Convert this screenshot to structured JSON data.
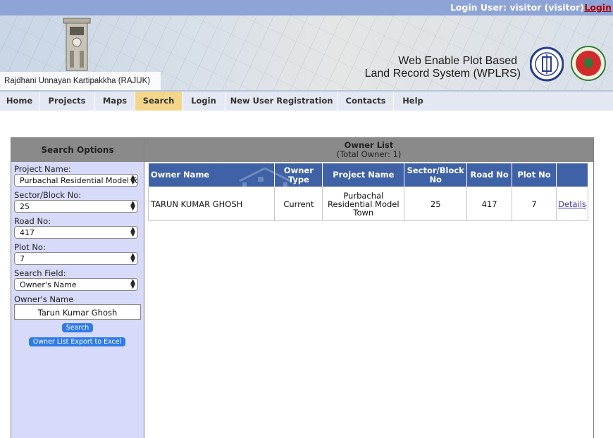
{
  "top": {
    "login_user": "Login User: visitor (visitor)",
    "login_link": "Login"
  },
  "banner": {
    "org_name": "Rajdhani Unnayan Kartipakkha (RAJUK)",
    "title_line1": "Web Enable Plot Based",
    "title_line2": "Land Record System (WPLRS)"
  },
  "nav": {
    "items": [
      {
        "label": "Home"
      },
      {
        "label": "Projects"
      },
      {
        "label": "Maps"
      },
      {
        "label": "Search"
      },
      {
        "label": "Login"
      },
      {
        "label": "New User Registration"
      },
      {
        "label": "Contacts"
      },
      {
        "label": "Help"
      }
    ],
    "active": "Search"
  },
  "search": {
    "heading": "Search Options",
    "project_label": "Project Name:",
    "project_value": "Purbachal Residential Model Town",
    "sector_label": "Sector/Block No:",
    "sector_value": "25",
    "road_label": "Road No:",
    "road_value": "417",
    "plot_label": "Plot No:",
    "plot_value": "7",
    "field_label": "Search Field:",
    "field_value": "Owner's Name",
    "owner_label": "Owner's Name",
    "owner_value": "Tarun Kumar Ghosh",
    "search_button": "Search",
    "export_button": "Owner List Export to Excel"
  },
  "owner_list": {
    "title": "Owner List",
    "subtitle": "(Total Owner: 1)",
    "columns": [
      "Owner Name",
      "Owner Type",
      "Project Name",
      "Sector/Block No",
      "Road No",
      "Plot No"
    ],
    "rows": [
      {
        "owner_name": "TARUN KUMAR GHOSH",
        "owner_type": "Current",
        "project_name": "Purbachal Residential Model Town",
        "sector": "25",
        "road": "417",
        "plot": "7",
        "link": "Details"
      }
    ]
  },
  "colors": {
    "topbar": "#8ea4d6",
    "login_link": "#b00000",
    "nav_active": "#f3d68b",
    "table_header": "#3f62a6",
    "panel_bg": "#d8dafa",
    "button": "#2f7be8"
  }
}
